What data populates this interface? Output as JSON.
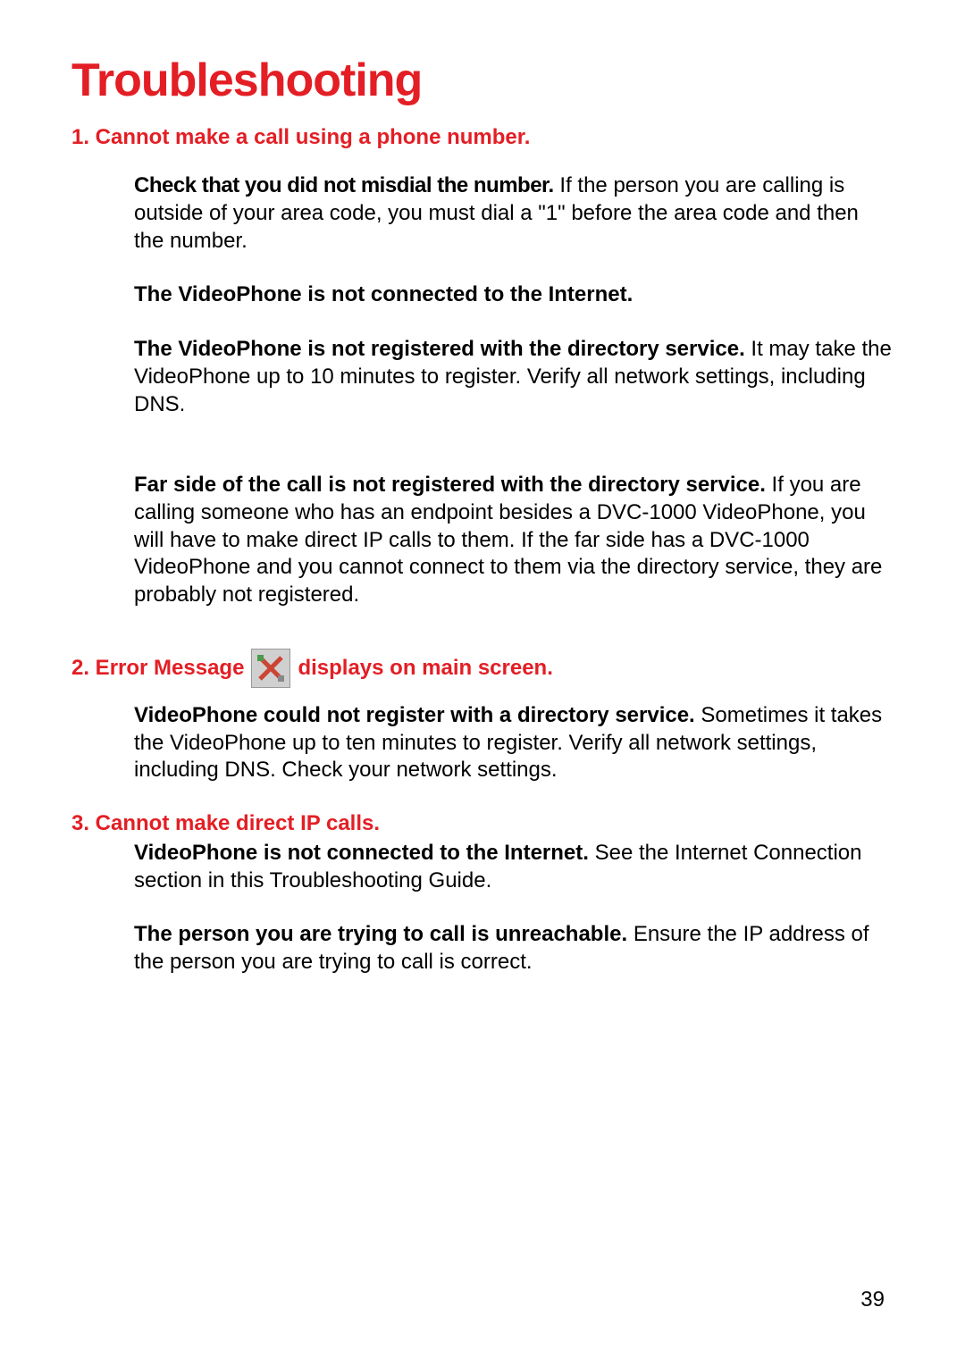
{
  "title": "Troubleshooting",
  "pageNumber": "39",
  "sections": [
    {
      "heading": "1. Cannot make a call using a phone number.",
      "paragraphs": [
        {
          "bold": "Check that you did not misdial the number.",
          "text": "  If the person you are calling is outside of your area code, you must dial a \"1\" before the area code and then the number."
        },
        {
          "bold": "The VideoPhone is not connected to the Internet.",
          "text": ""
        },
        {
          "bold": "The VideoPhone is not registered with the directory service.",
          "text": " It may take the VideoPhone up to 10 minutes to register.  Verify all network settings, including DNS."
        },
        {
          "bold": "Far side of the call is not registered with the directory service.",
          "text": " If you are calling someone who has an endpoint besides a DVC-1000 VideoPhone, you will have to make direct IP calls to them. If the far side has a DVC-1000 VideoPhone and you cannot connect to them via the directory service, they are probably not registered."
        }
      ]
    },
    {
      "headingPre": "2. Error Message",
      "headingPost": " displays on main screen.",
      "paragraphs": [
        {
          "bold": "VideoPhone could not register with a directory service.",
          "text": " Sometimes it takes the VideoPhone up to ten minutes to register. Verify all network settings, including DNS. Check your network settings."
        }
      ]
    },
    {
      "heading": "3. Cannot make direct IP calls.",
      "paragraphs": [
        {
          "bold": "VideoPhone is not connected to the Internet.",
          "text": " See the Internet Connection section in this Troubleshooting Guide."
        },
        {
          "bold": "The person you are trying to call is unreachable.",
          "text": " Ensure the IP address of the person you are trying to call is correct."
        }
      ]
    }
  ]
}
